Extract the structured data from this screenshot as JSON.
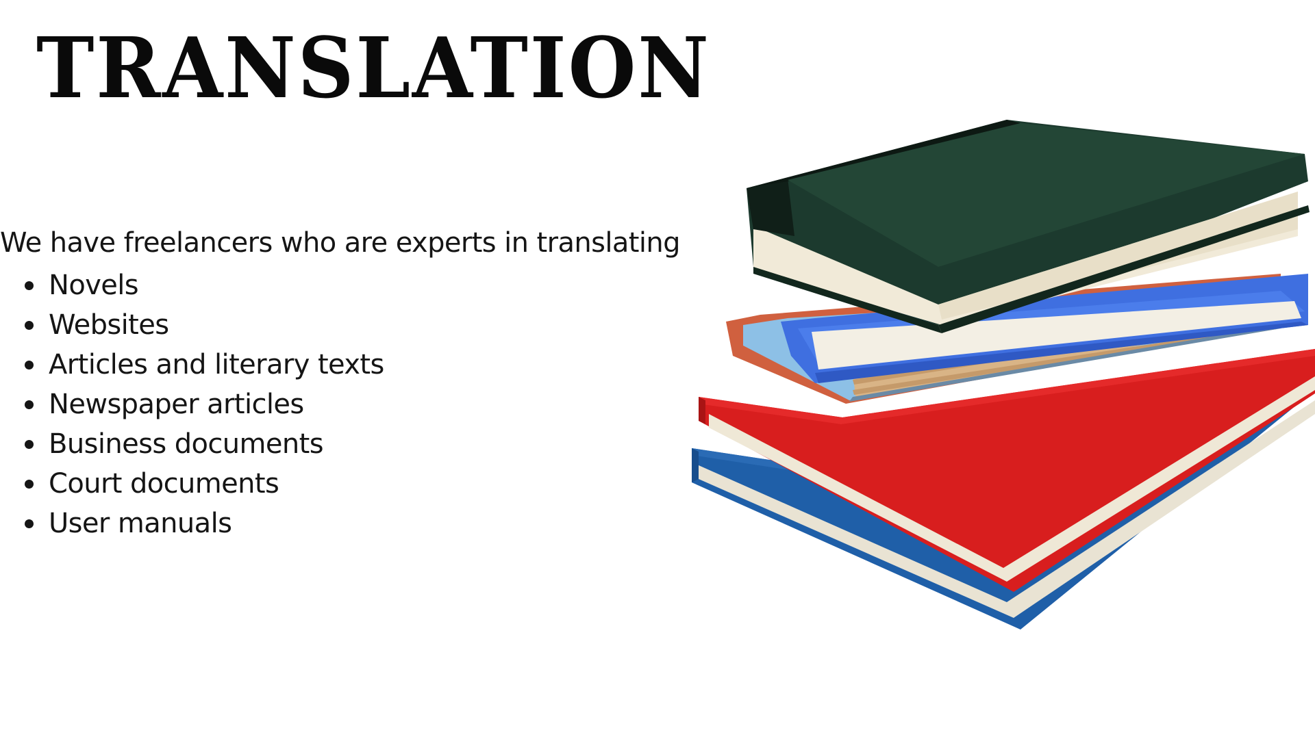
{
  "title": "TRANSLATION",
  "intro": "We have freelancers who are experts in translating",
  "services": [
    "Novels",
    "Websites",
    "Articles and literary texts",
    "Newspaper articles",
    "Business documents",
    "Court documents",
    "User manuals"
  ],
  "image": {
    "icon": "stack-of-books-illustration",
    "colors": {
      "green": "#1c3a2e",
      "blue": "#3f6fe0",
      "light_blue": "#7fb6e0",
      "red": "#d81e1e",
      "dark_blue": "#1f5fa8",
      "pages": "#f1ead8"
    }
  }
}
